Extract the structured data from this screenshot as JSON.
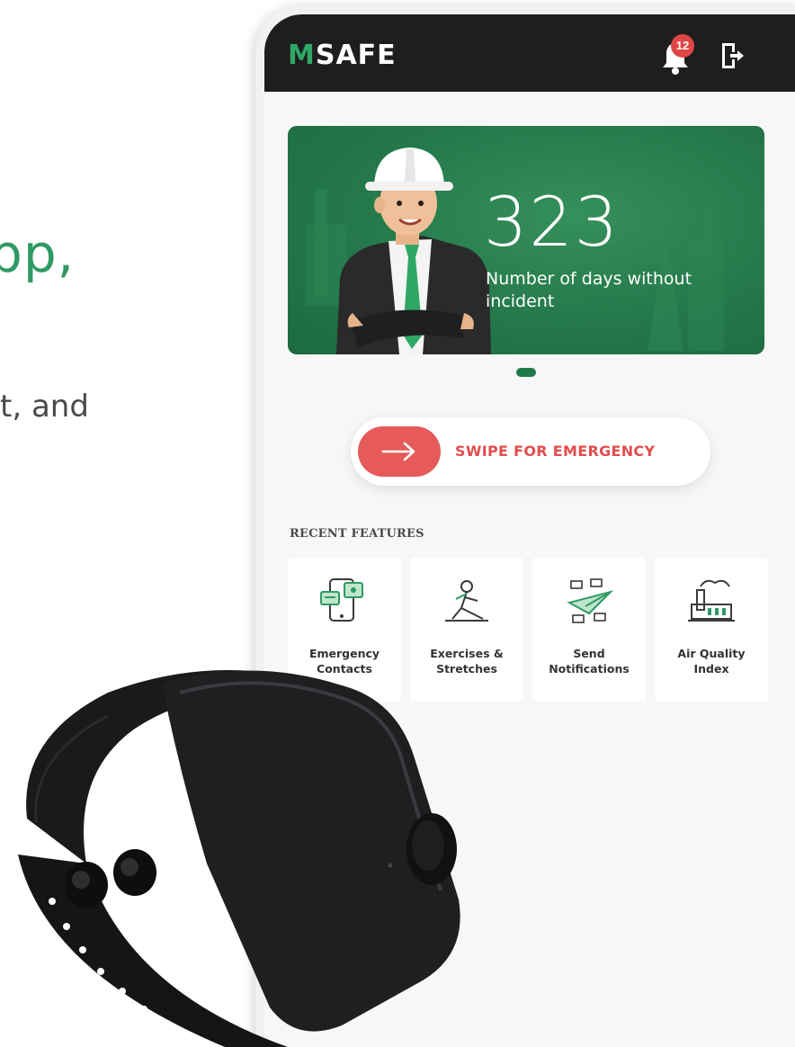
{
  "background": {
    "heading_fragment": "pp,",
    "subtext_fragment": "t, and"
  },
  "app": {
    "logo_prefix": "M",
    "logo_rest": "SAFE",
    "notification_count": "12",
    "icons": {
      "notifications": "bell-icon",
      "logout": "logout-icon"
    }
  },
  "banner": {
    "days_count": "323",
    "days_label": "Number of days without incident",
    "carousel_active_index": 0
  },
  "emergency": {
    "label": "SWIPE FOR EMERGENCY"
  },
  "recent_features": {
    "title": "RECENT FEATURES",
    "items": [
      {
        "label": "Emergency Contacts",
        "icon": "emergency-contacts-icon"
      },
      {
        "label": "Exercises & Stretches",
        "icon": "exercise-icon"
      },
      {
        "label": "Send Notifications",
        "icon": "send-notifications-icon"
      },
      {
        "label": "Air Quality Index",
        "icon": "air-quality-icon"
      }
    ]
  },
  "colors": {
    "brand_green": "#2f9a63",
    "banner_green": "#24784a",
    "emergency_red": "#e65a5a",
    "header_dark": "#1e1e1e"
  }
}
